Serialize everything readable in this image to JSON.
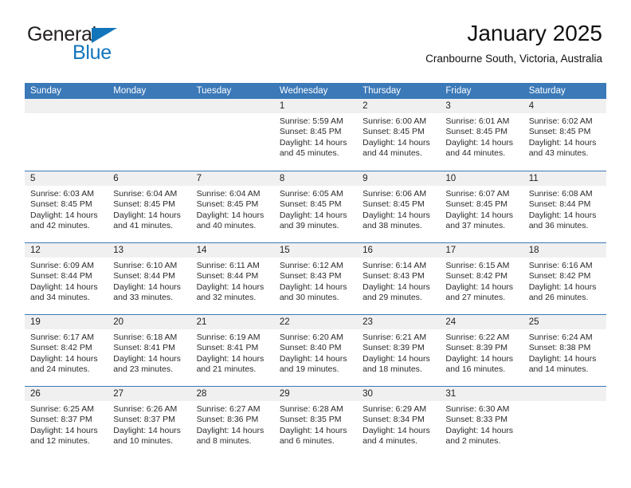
{
  "brand": {
    "name_part1": "General",
    "name_part2": "Blue",
    "triangle_icon": "blue-triangle-icon",
    "color_dark": "#231f20",
    "color_blue": "#1275bc"
  },
  "header": {
    "title": "January 2025",
    "subtitle": "Cranbourne South, Victoria, Australia"
  },
  "theme": {
    "header_blue": "#3b79b8",
    "day_band_gray": "#f0f0f0",
    "text_color": "#2b2b2b"
  },
  "weekdays": [
    "Sunday",
    "Monday",
    "Tuesday",
    "Wednesday",
    "Thursday",
    "Friday",
    "Saturday"
  ],
  "weeks": [
    [
      {
        "day": "",
        "sunrise": "",
        "sunset": "",
        "daylight_line1": "",
        "daylight_line2": ""
      },
      {
        "day": "",
        "sunrise": "",
        "sunset": "",
        "daylight_line1": "",
        "daylight_line2": ""
      },
      {
        "day": "",
        "sunrise": "",
        "sunset": "",
        "daylight_line1": "",
        "daylight_line2": ""
      },
      {
        "day": "1",
        "sunrise": "Sunrise: 5:59 AM",
        "sunset": "Sunset: 8:45 PM",
        "daylight_line1": "Daylight: 14 hours",
        "daylight_line2": "and 45 minutes."
      },
      {
        "day": "2",
        "sunrise": "Sunrise: 6:00 AM",
        "sunset": "Sunset: 8:45 PM",
        "daylight_line1": "Daylight: 14 hours",
        "daylight_line2": "and 44 minutes."
      },
      {
        "day": "3",
        "sunrise": "Sunrise: 6:01 AM",
        "sunset": "Sunset: 8:45 PM",
        "daylight_line1": "Daylight: 14 hours",
        "daylight_line2": "and 44 minutes."
      },
      {
        "day": "4",
        "sunrise": "Sunrise: 6:02 AM",
        "sunset": "Sunset: 8:45 PM",
        "daylight_line1": "Daylight: 14 hours",
        "daylight_line2": "and 43 minutes."
      }
    ],
    [
      {
        "day": "5",
        "sunrise": "Sunrise: 6:03 AM",
        "sunset": "Sunset: 8:45 PM",
        "daylight_line1": "Daylight: 14 hours",
        "daylight_line2": "and 42 minutes."
      },
      {
        "day": "6",
        "sunrise": "Sunrise: 6:04 AM",
        "sunset": "Sunset: 8:45 PM",
        "daylight_line1": "Daylight: 14 hours",
        "daylight_line2": "and 41 minutes."
      },
      {
        "day": "7",
        "sunrise": "Sunrise: 6:04 AM",
        "sunset": "Sunset: 8:45 PM",
        "daylight_line1": "Daylight: 14 hours",
        "daylight_line2": "and 40 minutes."
      },
      {
        "day": "8",
        "sunrise": "Sunrise: 6:05 AM",
        "sunset": "Sunset: 8:45 PM",
        "daylight_line1": "Daylight: 14 hours",
        "daylight_line2": "and 39 minutes."
      },
      {
        "day": "9",
        "sunrise": "Sunrise: 6:06 AM",
        "sunset": "Sunset: 8:45 PM",
        "daylight_line1": "Daylight: 14 hours",
        "daylight_line2": "and 38 minutes."
      },
      {
        "day": "10",
        "sunrise": "Sunrise: 6:07 AM",
        "sunset": "Sunset: 8:45 PM",
        "daylight_line1": "Daylight: 14 hours",
        "daylight_line2": "and 37 minutes."
      },
      {
        "day": "11",
        "sunrise": "Sunrise: 6:08 AM",
        "sunset": "Sunset: 8:44 PM",
        "daylight_line1": "Daylight: 14 hours",
        "daylight_line2": "and 36 minutes."
      }
    ],
    [
      {
        "day": "12",
        "sunrise": "Sunrise: 6:09 AM",
        "sunset": "Sunset: 8:44 PM",
        "daylight_line1": "Daylight: 14 hours",
        "daylight_line2": "and 34 minutes."
      },
      {
        "day": "13",
        "sunrise": "Sunrise: 6:10 AM",
        "sunset": "Sunset: 8:44 PM",
        "daylight_line1": "Daylight: 14 hours",
        "daylight_line2": "and 33 minutes."
      },
      {
        "day": "14",
        "sunrise": "Sunrise: 6:11 AM",
        "sunset": "Sunset: 8:44 PM",
        "daylight_line1": "Daylight: 14 hours",
        "daylight_line2": "and 32 minutes."
      },
      {
        "day": "15",
        "sunrise": "Sunrise: 6:12 AM",
        "sunset": "Sunset: 8:43 PM",
        "daylight_line1": "Daylight: 14 hours",
        "daylight_line2": "and 30 minutes."
      },
      {
        "day": "16",
        "sunrise": "Sunrise: 6:14 AM",
        "sunset": "Sunset: 8:43 PM",
        "daylight_line1": "Daylight: 14 hours",
        "daylight_line2": "and 29 minutes."
      },
      {
        "day": "17",
        "sunrise": "Sunrise: 6:15 AM",
        "sunset": "Sunset: 8:42 PM",
        "daylight_line1": "Daylight: 14 hours",
        "daylight_line2": "and 27 minutes."
      },
      {
        "day": "18",
        "sunrise": "Sunrise: 6:16 AM",
        "sunset": "Sunset: 8:42 PM",
        "daylight_line1": "Daylight: 14 hours",
        "daylight_line2": "and 26 minutes."
      }
    ],
    [
      {
        "day": "19",
        "sunrise": "Sunrise: 6:17 AM",
        "sunset": "Sunset: 8:42 PM",
        "daylight_line1": "Daylight: 14 hours",
        "daylight_line2": "and 24 minutes."
      },
      {
        "day": "20",
        "sunrise": "Sunrise: 6:18 AM",
        "sunset": "Sunset: 8:41 PM",
        "daylight_line1": "Daylight: 14 hours",
        "daylight_line2": "and 23 minutes."
      },
      {
        "day": "21",
        "sunrise": "Sunrise: 6:19 AM",
        "sunset": "Sunset: 8:41 PM",
        "daylight_line1": "Daylight: 14 hours",
        "daylight_line2": "and 21 minutes."
      },
      {
        "day": "22",
        "sunrise": "Sunrise: 6:20 AM",
        "sunset": "Sunset: 8:40 PM",
        "daylight_line1": "Daylight: 14 hours",
        "daylight_line2": "and 19 minutes."
      },
      {
        "day": "23",
        "sunrise": "Sunrise: 6:21 AM",
        "sunset": "Sunset: 8:39 PM",
        "daylight_line1": "Daylight: 14 hours",
        "daylight_line2": "and 18 minutes."
      },
      {
        "day": "24",
        "sunrise": "Sunrise: 6:22 AM",
        "sunset": "Sunset: 8:39 PM",
        "daylight_line1": "Daylight: 14 hours",
        "daylight_line2": "and 16 minutes."
      },
      {
        "day": "25",
        "sunrise": "Sunrise: 6:24 AM",
        "sunset": "Sunset: 8:38 PM",
        "daylight_line1": "Daylight: 14 hours",
        "daylight_line2": "and 14 minutes."
      }
    ],
    [
      {
        "day": "26",
        "sunrise": "Sunrise: 6:25 AM",
        "sunset": "Sunset: 8:37 PM",
        "daylight_line1": "Daylight: 14 hours",
        "daylight_line2": "and 12 minutes."
      },
      {
        "day": "27",
        "sunrise": "Sunrise: 6:26 AM",
        "sunset": "Sunset: 8:37 PM",
        "daylight_line1": "Daylight: 14 hours",
        "daylight_line2": "and 10 minutes."
      },
      {
        "day": "28",
        "sunrise": "Sunrise: 6:27 AM",
        "sunset": "Sunset: 8:36 PM",
        "daylight_line1": "Daylight: 14 hours",
        "daylight_line2": "and 8 minutes."
      },
      {
        "day": "29",
        "sunrise": "Sunrise: 6:28 AM",
        "sunset": "Sunset: 8:35 PM",
        "daylight_line1": "Daylight: 14 hours",
        "daylight_line2": "and 6 minutes."
      },
      {
        "day": "30",
        "sunrise": "Sunrise: 6:29 AM",
        "sunset": "Sunset: 8:34 PM",
        "daylight_line1": "Daylight: 14 hours",
        "daylight_line2": "and 4 minutes."
      },
      {
        "day": "31",
        "sunrise": "Sunrise: 6:30 AM",
        "sunset": "Sunset: 8:33 PM",
        "daylight_line1": "Daylight: 14 hours",
        "daylight_line2": "and 2 minutes."
      },
      {
        "day": "",
        "sunrise": "",
        "sunset": "",
        "daylight_line1": "",
        "daylight_line2": ""
      }
    ]
  ]
}
